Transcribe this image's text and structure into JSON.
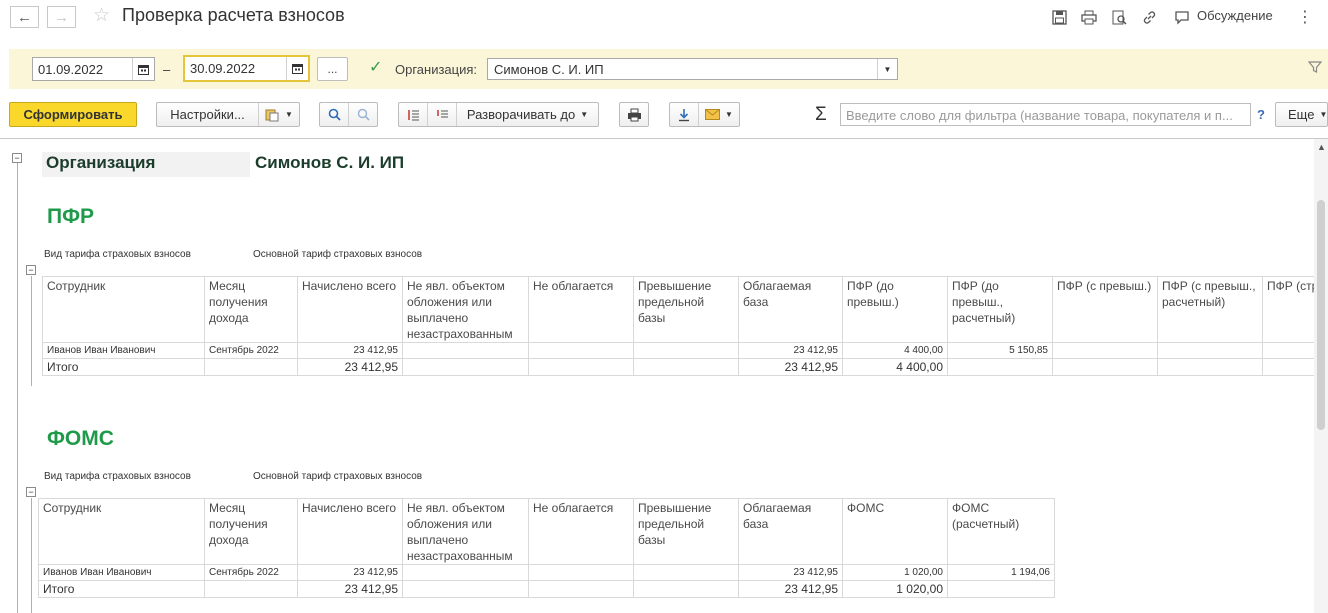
{
  "window": {
    "title": "Проверка расчета взносов",
    "discussion_label": "Обсуждение"
  },
  "filters": {
    "date_from": "01.09.2022",
    "date_to": "30.09.2022",
    "dash": "–",
    "period_button": "...",
    "organization_label": "Организация:",
    "organization_value": "Симонов С. И. ИП",
    "organization_checked": true
  },
  "toolbar": {
    "generate": "Сформировать",
    "settings": "Настройки...",
    "expand_to": "Разворачивать до",
    "filter_placeholder": "Введите слово для фильтра (название товара, покупателя и п...",
    "help": "?",
    "more": "Еще"
  },
  "report": {
    "org_label": "Организация",
    "org_value": "Симонов С. И. ИП",
    "pfr": {
      "title": "ПФР",
      "tariff_label": "Вид тарифа страховых взносов",
      "tariff_value": "Основной тариф страховых взносов",
      "headers": [
        "Сотрудник",
        "Месяц получения дохода",
        "Начислено всего",
        "Не явл. объектом обложения или выплачено незастрахованным",
        "Не облагается",
        "Превышение предельной базы",
        "Облагаемая база",
        "ПФР (до превыш.)",
        "ПФР (до превыш., расчетный)",
        "ПФР (с превыш.)",
        "ПФР (с превыш., расчетный)",
        "ПФР (стр"
      ],
      "row": [
        "Иванов Иван Иванович",
        "Сентябрь 2022",
        "23 412,95",
        "",
        "",
        "",
        "23 412,95",
        "4 400,00",
        "5 150,85",
        "",
        "",
        ""
      ],
      "total": [
        "Итого",
        "",
        "23 412,95",
        "",
        "",
        "",
        "23 412,95",
        "4 400,00",
        "",
        "",
        "",
        ""
      ]
    },
    "foms": {
      "title": "ФОМС",
      "tariff_label": "Вид тарифа страховых взносов",
      "tariff_value": "Основной тариф страховых взносов",
      "headers": [
        "Сотрудник",
        "Месяц получения дохода",
        "Начислено всего",
        "Не явл. объектом обложения или выплачено незастрахованным",
        "Не облагается",
        "Превышение предельной базы",
        "Облагаемая база",
        "ФОМС",
        "ФОМС (расчетный)"
      ],
      "row": [
        "Иванов Иван Иванович",
        "Сентябрь 2022",
        "23 412,95",
        "",
        "",
        "",
        "23 412,95",
        "1 020,00",
        "1 194,06"
      ],
      "total": [
        "Итого",
        "",
        "23 412,95",
        "",
        "",
        "",
        "23 412,95",
        "1 020,00",
        ""
      ]
    }
  }
}
